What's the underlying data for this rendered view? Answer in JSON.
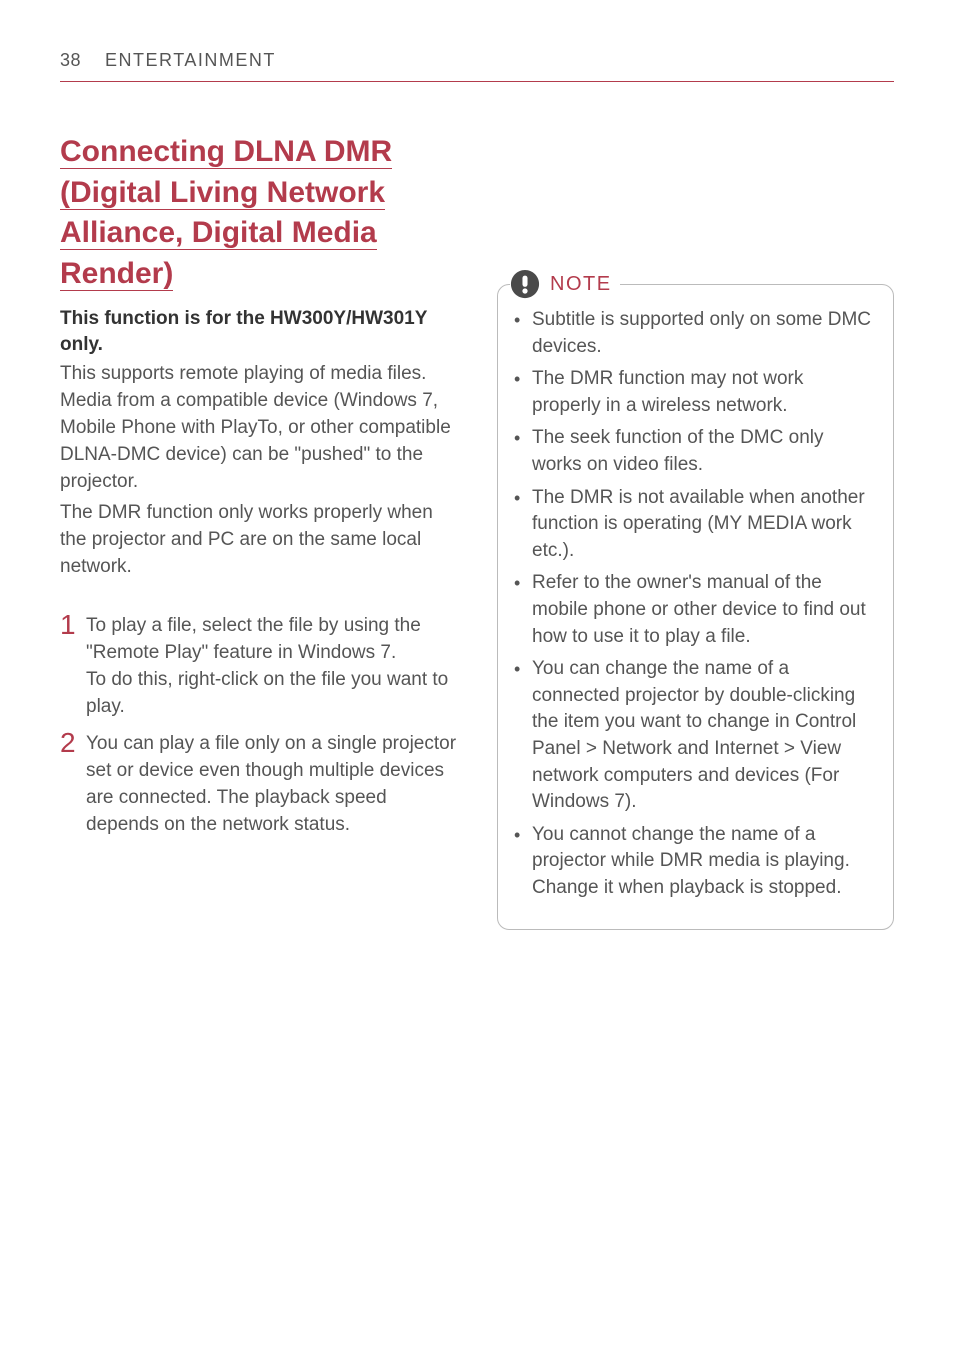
{
  "header": {
    "page_number": "38",
    "section_title": "ENTERTAINMENT"
  },
  "left": {
    "heading": "Connecting DLNA DMR (Digital Living Network Alliance, Digital Media Render)",
    "subhead": "This function is for the HW300Y/HW301Y only.",
    "para1": "This supports remote playing of media files. Media from a compatible device (Windows 7, Mobile Phone with PlayTo, or other compatible DLNA-DMC device) can be \"pushed\" to the projector.",
    "para2": "The DMR function only works properly when the projector and PC are on the same local network.",
    "steps": [
      {
        "num": "1",
        "text_a": "To play a file, select the file by using the \"Remote Play\" feature in Windows 7.",
        "text_b": "To do this, right-click on the file you want to play."
      },
      {
        "num": "2",
        "text_a": "You can play a file only on a single projector set or device even though multiple devices are connected. The playback speed depends on the network status.",
        "text_b": ""
      }
    ]
  },
  "note": {
    "label": "NOTE",
    "items": [
      "Subtitle is supported only on some DMC devices.",
      "The DMR function may not work properly in a wireless network.",
      "The seek function of the DMC only works on video files.",
      "The DMR is not available when another function is operating (MY MEDIA work etc.).",
      "Refer to the owner's manual of the mobile phone or other device to find out how to use it to play a file.",
      "You can change the name of a connected projector by double-clicking the item you want to change in Control Panel > Network and Internet > View network computers and devices (For Windows 7).",
      "You cannot change the name of a projector while DMR media is playing. Change it when playback is stopped."
    ]
  }
}
